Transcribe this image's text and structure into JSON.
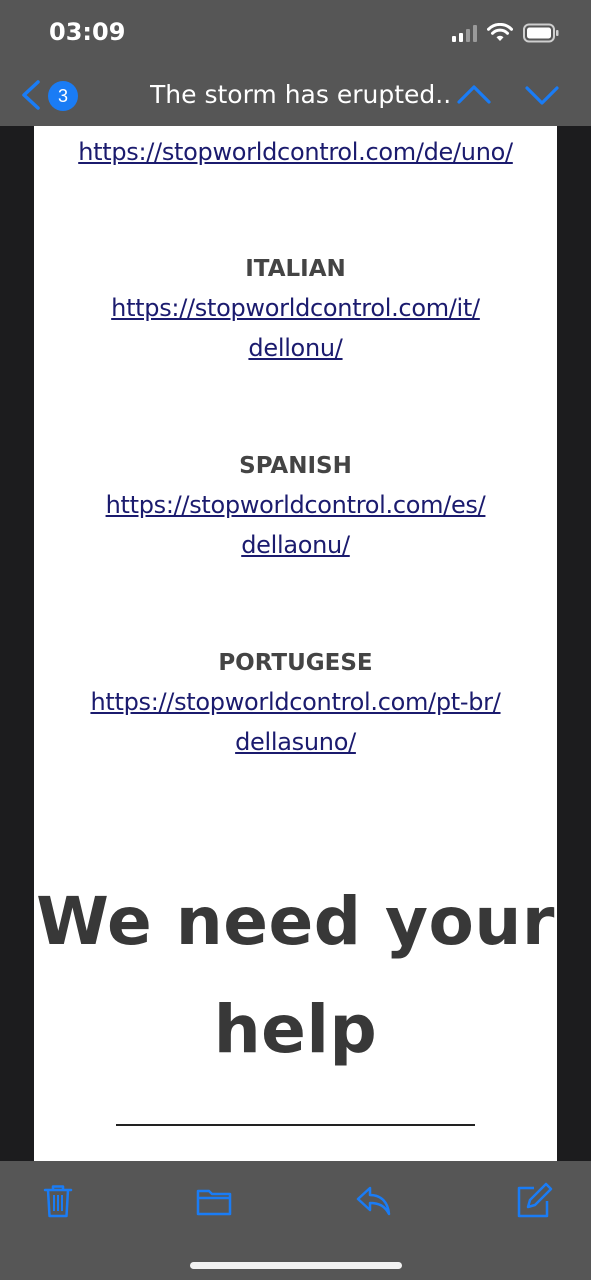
{
  "status_bar": {
    "time": "03:09"
  },
  "nav": {
    "badge_count": "3",
    "title": "The storm has erupted..."
  },
  "email": {
    "german_link_tail": "https://stopworldcontrol.com/de/uno/",
    "sections": [
      {
        "heading": "ITALIAN",
        "link_line1": "https://stopworldcontrol.com/it/",
        "link_line2": "dellonu/"
      },
      {
        "heading": "SPANISH",
        "link_line1": "https://stopworldcontrol.com/es/",
        "link_line2": "dellaonu/"
      },
      {
        "heading": "PORTUGESE",
        "link_line1": "https://stopworldcontrol.com/pt-br/",
        "link_line2": "dellasuno/"
      }
    ],
    "help_line1": "We need your",
    "help_line2": "help"
  },
  "toolbar": {
    "icons": [
      "trash-icon",
      "folder-icon",
      "reply-icon",
      "compose-icon"
    ]
  },
  "colors": {
    "bar_bg": "#565656",
    "accent": "#1a7cf5",
    "link": "#1b1b6e",
    "heading": "#444444"
  }
}
